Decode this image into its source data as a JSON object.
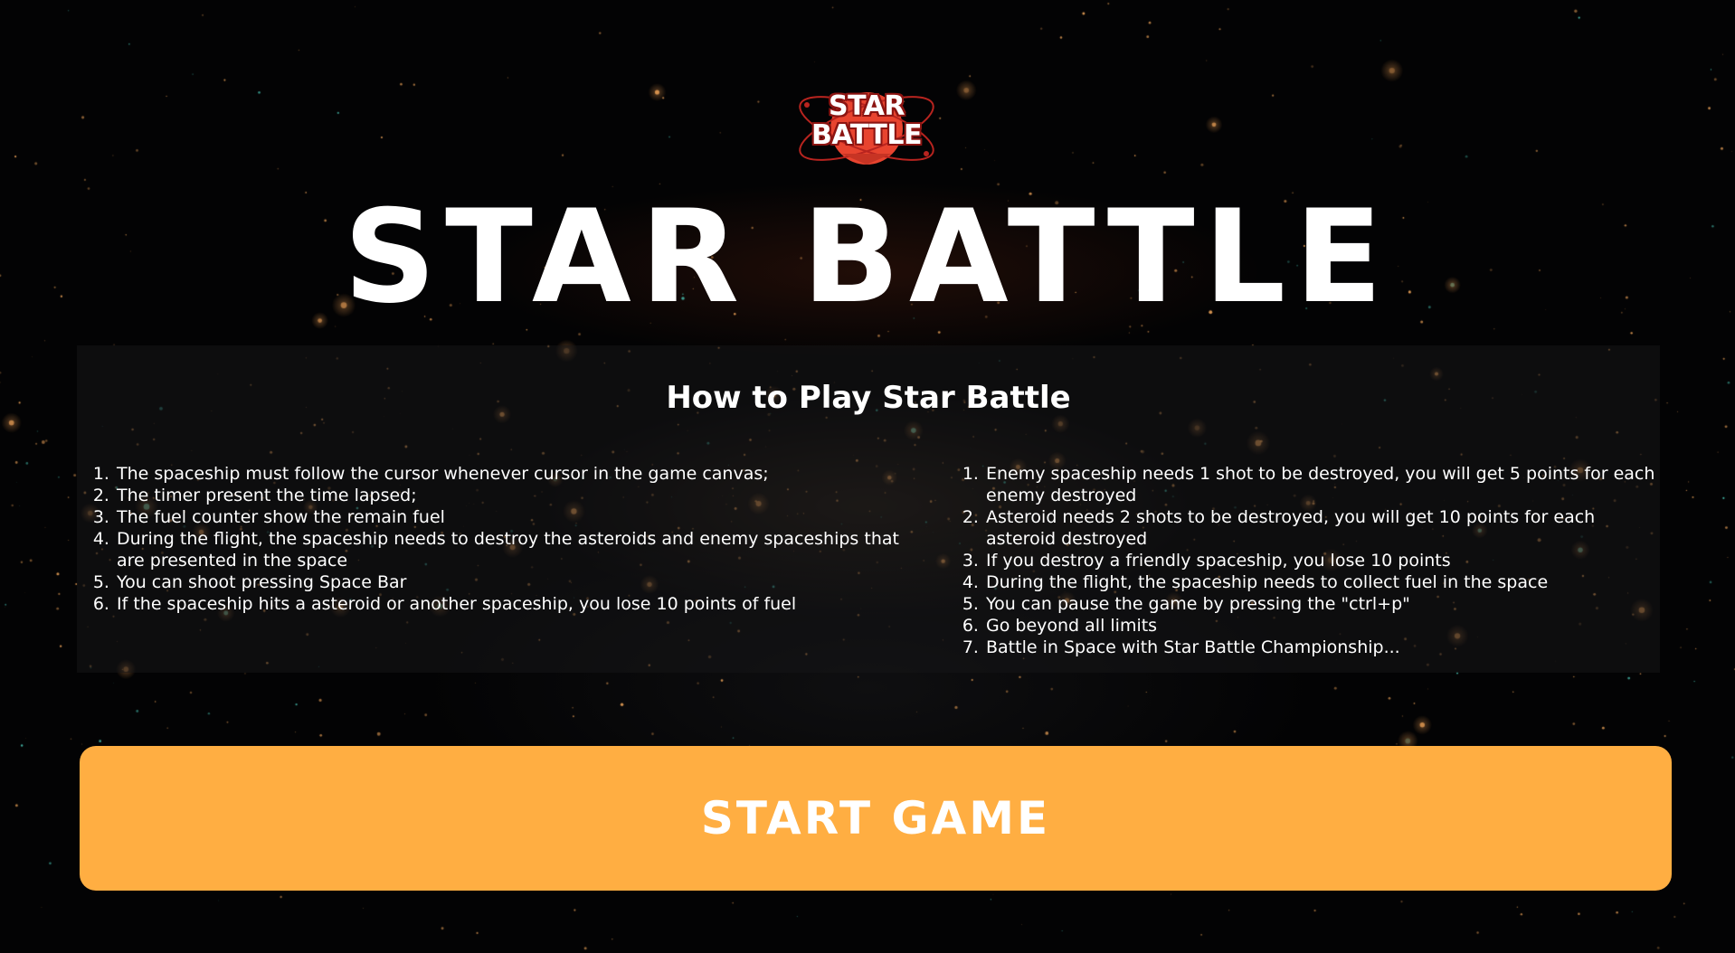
{
  "logo": {
    "line1": "STAR",
    "line2": "BATTLE",
    "colors": {
      "disc": "#e8442f",
      "ring": "#b8241f",
      "outline": "#8c1512"
    }
  },
  "title": "STAR BATTLE",
  "instructions": {
    "title": "How to Play Star Battle",
    "left_rules": [
      "The spaceship must follow the cursor whenever cursor in the game canvas;",
      "The timer present the time lapsed;",
      "The fuel counter show the remain fuel",
      "During the flight, the spaceship needs to destroy the asteroids and enemy spaceships that are presented in the space",
      "You can shoot pressing Space Bar",
      "If the spaceship hits a asteroid or another spaceship, you lose 10 points of fuel"
    ],
    "right_rules": [
      "Enemy spaceship needs 1 shot to be destroyed, you will get 5 points for each enemy destroyed",
      "Asteroid needs 2 shots to be destroyed, you will get 10 points for each asteroid destroyed",
      "If you destroy a friendly spaceship, you lose 10 points",
      "During the flight, the spaceship needs to collect fuel in the space",
      "You can pause the game by pressing the \"ctrl+p\"",
      "Go beyond all limits",
      "Battle in Space with Star Battle Championship..."
    ]
  },
  "start_button": {
    "label": "START GAME"
  },
  "colors": {
    "background": "#030304",
    "button": "#ffae42",
    "text": "#ffffff",
    "star_warm": "#ffb060",
    "star_cool": "#4fd6c4"
  }
}
